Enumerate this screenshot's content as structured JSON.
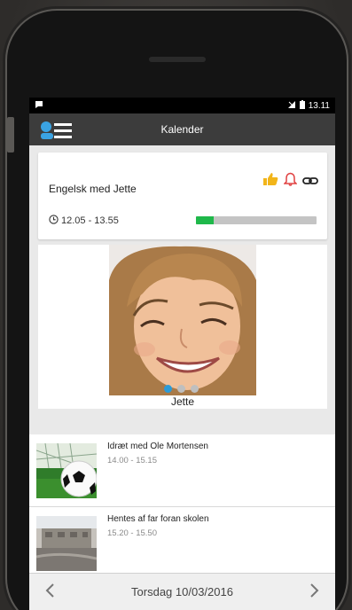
{
  "status_bar": {
    "time": "13.11",
    "notification_icon": "notification-icon",
    "signal_icon": "signal-icon",
    "battery_icon": "battery-icon"
  },
  "app_bar": {
    "title": "Kalender",
    "logo_icon": "app-logo-icon"
  },
  "current_event": {
    "title": "Engelsk med Jette",
    "time": "12.05 - 13.55",
    "progress": 0.15,
    "icons": [
      "thumbs-up-icon",
      "bell-icon",
      "link-icon"
    ],
    "colors": {
      "progress_fill": "#1fb84a",
      "thumbs_up": "#f2b51a",
      "bell": "#e04040"
    }
  },
  "participant": {
    "name": "Jette",
    "carousel_pages": 3,
    "carousel_active": 0
  },
  "events": [
    {
      "title": "Idræt med Ole Mortensen",
      "time": "14.00 - 15.15",
      "thumb": "soccer-ball-photo"
    },
    {
      "title": "Hentes af far foran skolen",
      "time": "15.20 - 15.50",
      "thumb": "school-building-photo"
    }
  ],
  "footer": {
    "date": "Torsdag 10/03/2016",
    "prev_icon": "chevron-left-icon",
    "next_icon": "chevron-right-icon"
  }
}
